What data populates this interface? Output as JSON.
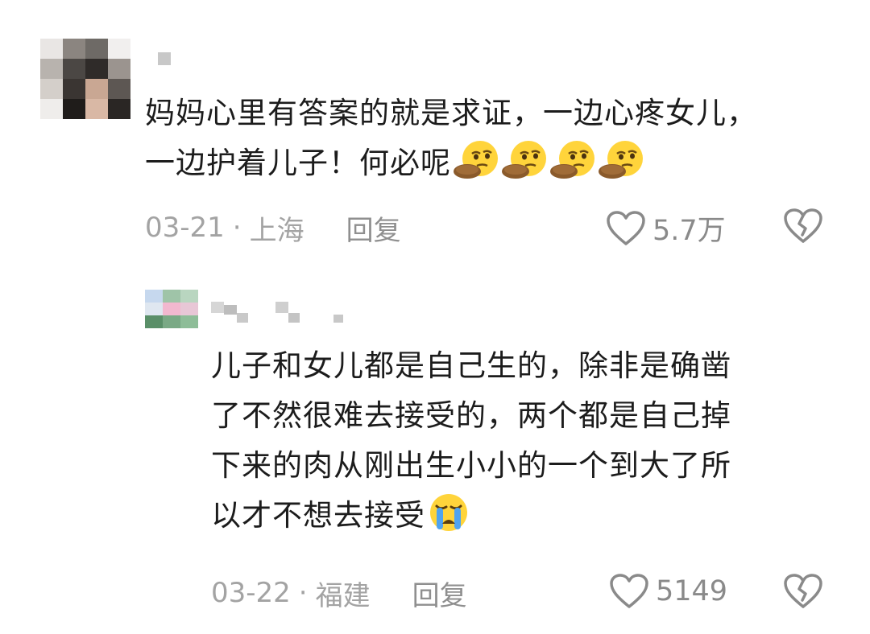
{
  "comments": [
    {
      "text_lines": [
        "妈妈心里有答案的就是求证，一边心疼女儿，",
        "一边护着儿子！何必呢"
      ],
      "emojis": [
        "thinking-face-emoji",
        "thinking-face-emoji",
        "thinking-face-emoji",
        "thinking-face-emoji"
      ],
      "date": "03-21",
      "separator": "·",
      "location": "上海",
      "reply_label": "回复",
      "likes": "5.7万"
    },
    {
      "text_lines": [
        "儿子和女儿都是自己生的，除非是确凿",
        "了不然很难去接受的，两个都是自己掉",
        "下来的肉从刚出生小小的一个到大了所",
        "以才不想去接受"
      ],
      "emojis": [
        "loudly-crying-face-emoji"
      ],
      "date": "03-22",
      "separator": "·",
      "location": "福建",
      "reply_label": "回复",
      "likes": "5149"
    }
  ],
  "colors": {
    "text": "#1c1c1c",
    "meta": "#a3a3a3",
    "icon": "#8a8a8a",
    "emoji_yellow": "#ffd43b"
  }
}
